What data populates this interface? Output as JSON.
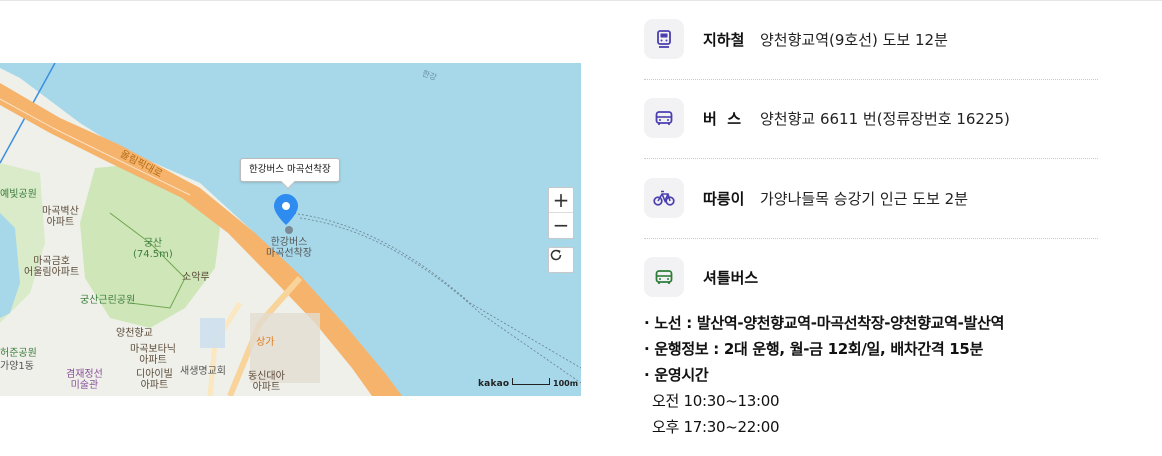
{
  "map": {
    "marker_tooltip": "한강버스 마곡선착장",
    "zoom_in_label": "+",
    "zoom_out_label": "−",
    "provider_logo": "kakao",
    "scale_label": "100m",
    "labels": {
      "road": "올림픽대로",
      "pier": "한강버스\n마곡선착장",
      "park1": "예빛공원",
      "apt1": "마곡벽산\n아파트",
      "apt2": "마곡금호\n어울림아파트",
      "mountain": "궁산\n(74.5m)",
      "pavilion": "소악루",
      "park2": "궁산근린공원",
      "school": "양천향교",
      "park3": "허준공원",
      "dong": "가양1동",
      "apt3": "마곡보타닉\n아파트",
      "museum": "겸재정선\n미술관",
      "apt4": "디아이빌\n아파트",
      "church": "새생명교회",
      "market": "상가",
      "apt5": "동신대아\n아파트",
      "river": "한강"
    }
  },
  "transport": [
    {
      "icon": "subway-icon",
      "label": "지하철",
      "value": "양천향교역(9호선) 도보 12분"
    },
    {
      "icon": "bus-icon",
      "label": "버  스",
      "value": "양천향교 6611 번(정류장번호 16225)"
    },
    {
      "icon": "bicycle-icon",
      "label": "따릉이",
      "value": "가양나들목 승강기 인근 도보 2분"
    },
    {
      "icon": "shuttle-bus-icon",
      "label": "셔틀버스",
      "value": ""
    }
  ],
  "shuttle": {
    "route_key": "· 노선 : ",
    "route_value": "발산역-양천향교역-마곡선착장-양천향교역-발산역",
    "info_key": "· 운행정보 : ",
    "info_value": "2대 운행, 월-금 12회/일, 배차간격 15분",
    "hours_key": "· 운영시간",
    "hours_am": "오전 10:30~13:00",
    "hours_pm": "오후 17:30~22:00"
  },
  "colors": {
    "subway": "#4b3fb0",
    "bus": "#4b3fb0",
    "bicycle": "#4b3fb0",
    "shuttle": "#2f7d3a",
    "water": "#a7d8ea",
    "road": "#f6b36b",
    "marker": "#2e8bf0"
  }
}
